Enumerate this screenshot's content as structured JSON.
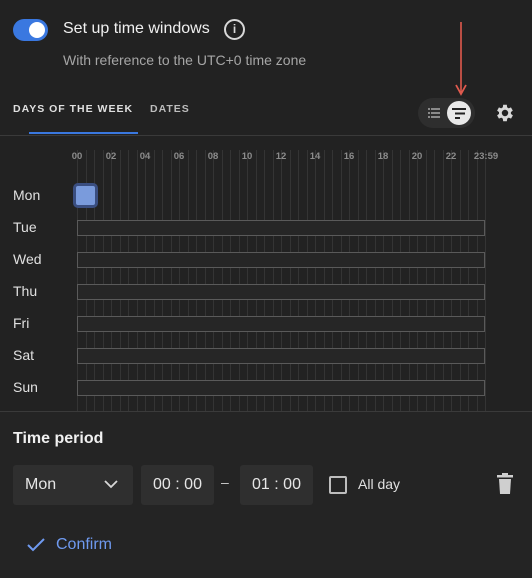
{
  "header": {
    "toggle_on": true,
    "title": "Set up time windows",
    "info_glyph": "i",
    "subtitle": "With reference to the UTC+0 time zone"
  },
  "tabs": [
    {
      "label": "DAYS OF THE WEEK",
      "active": true
    },
    {
      "label": "DATES",
      "active": false
    }
  ],
  "view_switch": {
    "options": [
      "list-view-icon",
      "timeline-view-icon"
    ],
    "selected": "timeline-view-icon"
  },
  "grid": {
    "hours": [
      "00",
      "02",
      "04",
      "06",
      "08",
      "10",
      "12",
      "14",
      "16",
      "18",
      "20",
      "22",
      "23:59"
    ],
    "days": [
      "Mon",
      "Tue",
      "Wed",
      "Thu",
      "Fri",
      "Sat",
      "Sun"
    ],
    "selected_slot": {
      "day": "Mon",
      "start": "00:00",
      "end": "01:00"
    }
  },
  "time_period": {
    "title": "Time period",
    "day": "Mon",
    "start": "00 : 00",
    "separator": "–",
    "end": "01 : 00",
    "all_day_label": "All day",
    "all_day_checked": false
  },
  "actions": {
    "confirm_label": "Confirm"
  },
  "colors": {
    "accent": "#3a78e0",
    "background": "#222222",
    "selected_slot": "#7a9bdc",
    "annotation_arrow": "#e05a4e"
  }
}
